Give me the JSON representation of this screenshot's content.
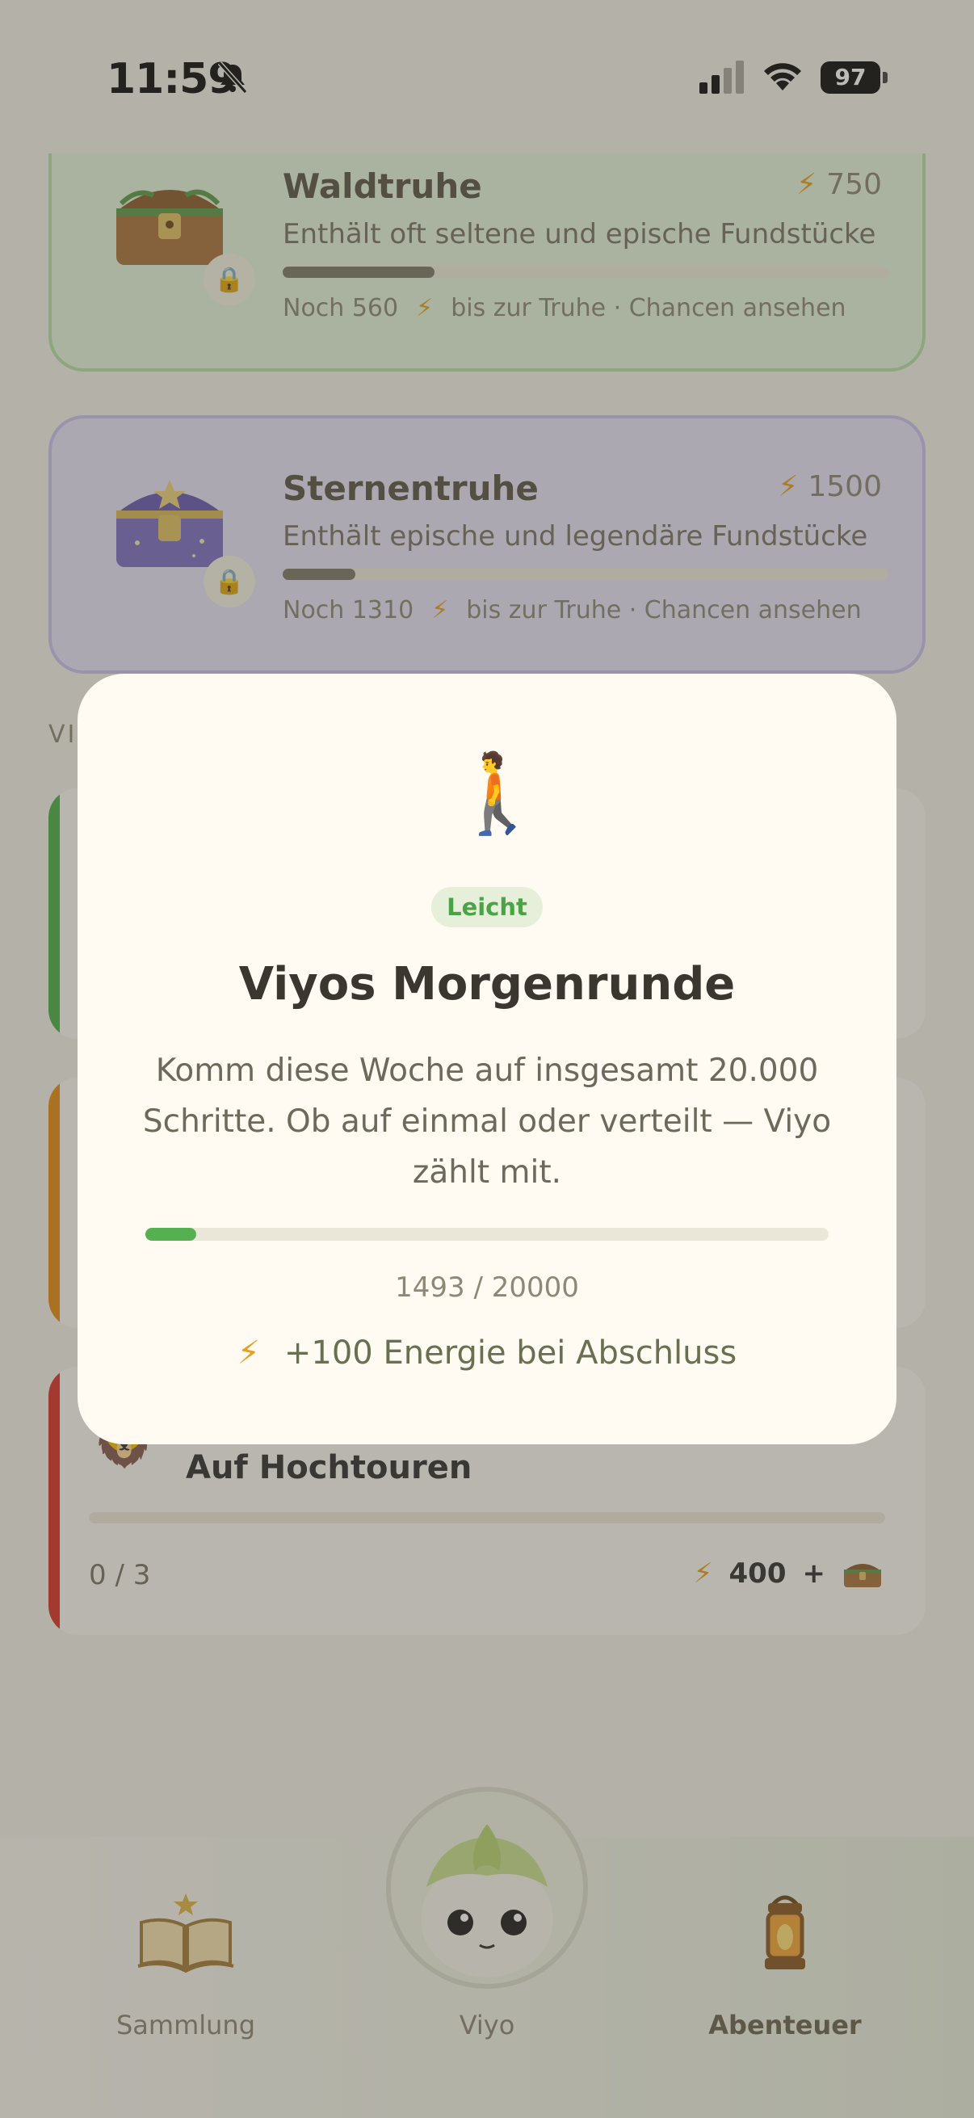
{
  "status_bar": {
    "time": "11:59",
    "battery": "97"
  },
  "chests": [
    {
      "title": "Waldtruhe",
      "cost": "750",
      "description": "Enthält oft seltene und epische Fundstücke",
      "progress_fraction": 0.25,
      "remaining": "Noch 560",
      "footer_suffix": "bis zur Truhe · Chancen ansehen"
    },
    {
      "title": "Sternentruhe",
      "cost": "1500",
      "description": "Enthält epische und legendäre Fundstücke",
      "progress_fraction": 0.12,
      "remaining": "Noch 1310",
      "footer_suffix": "bis zur Truhe · Chancen ansehen"
    }
  ],
  "section_label": "VI",
  "quests": [
    {
      "stripe_color": "#4cae4a"
    },
    {
      "stripe_color": "#e38c18"
    },
    {
      "stripe_color": "#d9342b",
      "name": "Auf Hochtouren",
      "progress": "0 / 3",
      "reward": "400",
      "reward_plus": "+"
    }
  ],
  "modal": {
    "icon": "🚶",
    "difficulty": "Leicht",
    "title": "Viyos Morgenrunde",
    "description": "Komm diese Woche auf insgesamt 20.000 Schritte. Ob auf einmal oder verteilt — Viyo zählt mit.",
    "progress_fraction": 0.07465,
    "progress_text": "1493 / 20000",
    "reward_text": "+100 Energie bei Abschluss"
  },
  "nav": {
    "sammlung": "Sammlung",
    "viyo": "Viyo",
    "abenteuer": "Abenteuer"
  },
  "colors": {
    "accent_green": "#55b14f",
    "energy": "#e3a021"
  },
  "icons": [
    "bell-slash-icon",
    "signal-icon",
    "wifi-icon",
    "battery-icon",
    "chest-icon",
    "lock-icon",
    "bolt-icon",
    "lion-icon",
    "walker-icon",
    "book-star-icon",
    "lantern-icon",
    "viyo-avatar"
  ]
}
